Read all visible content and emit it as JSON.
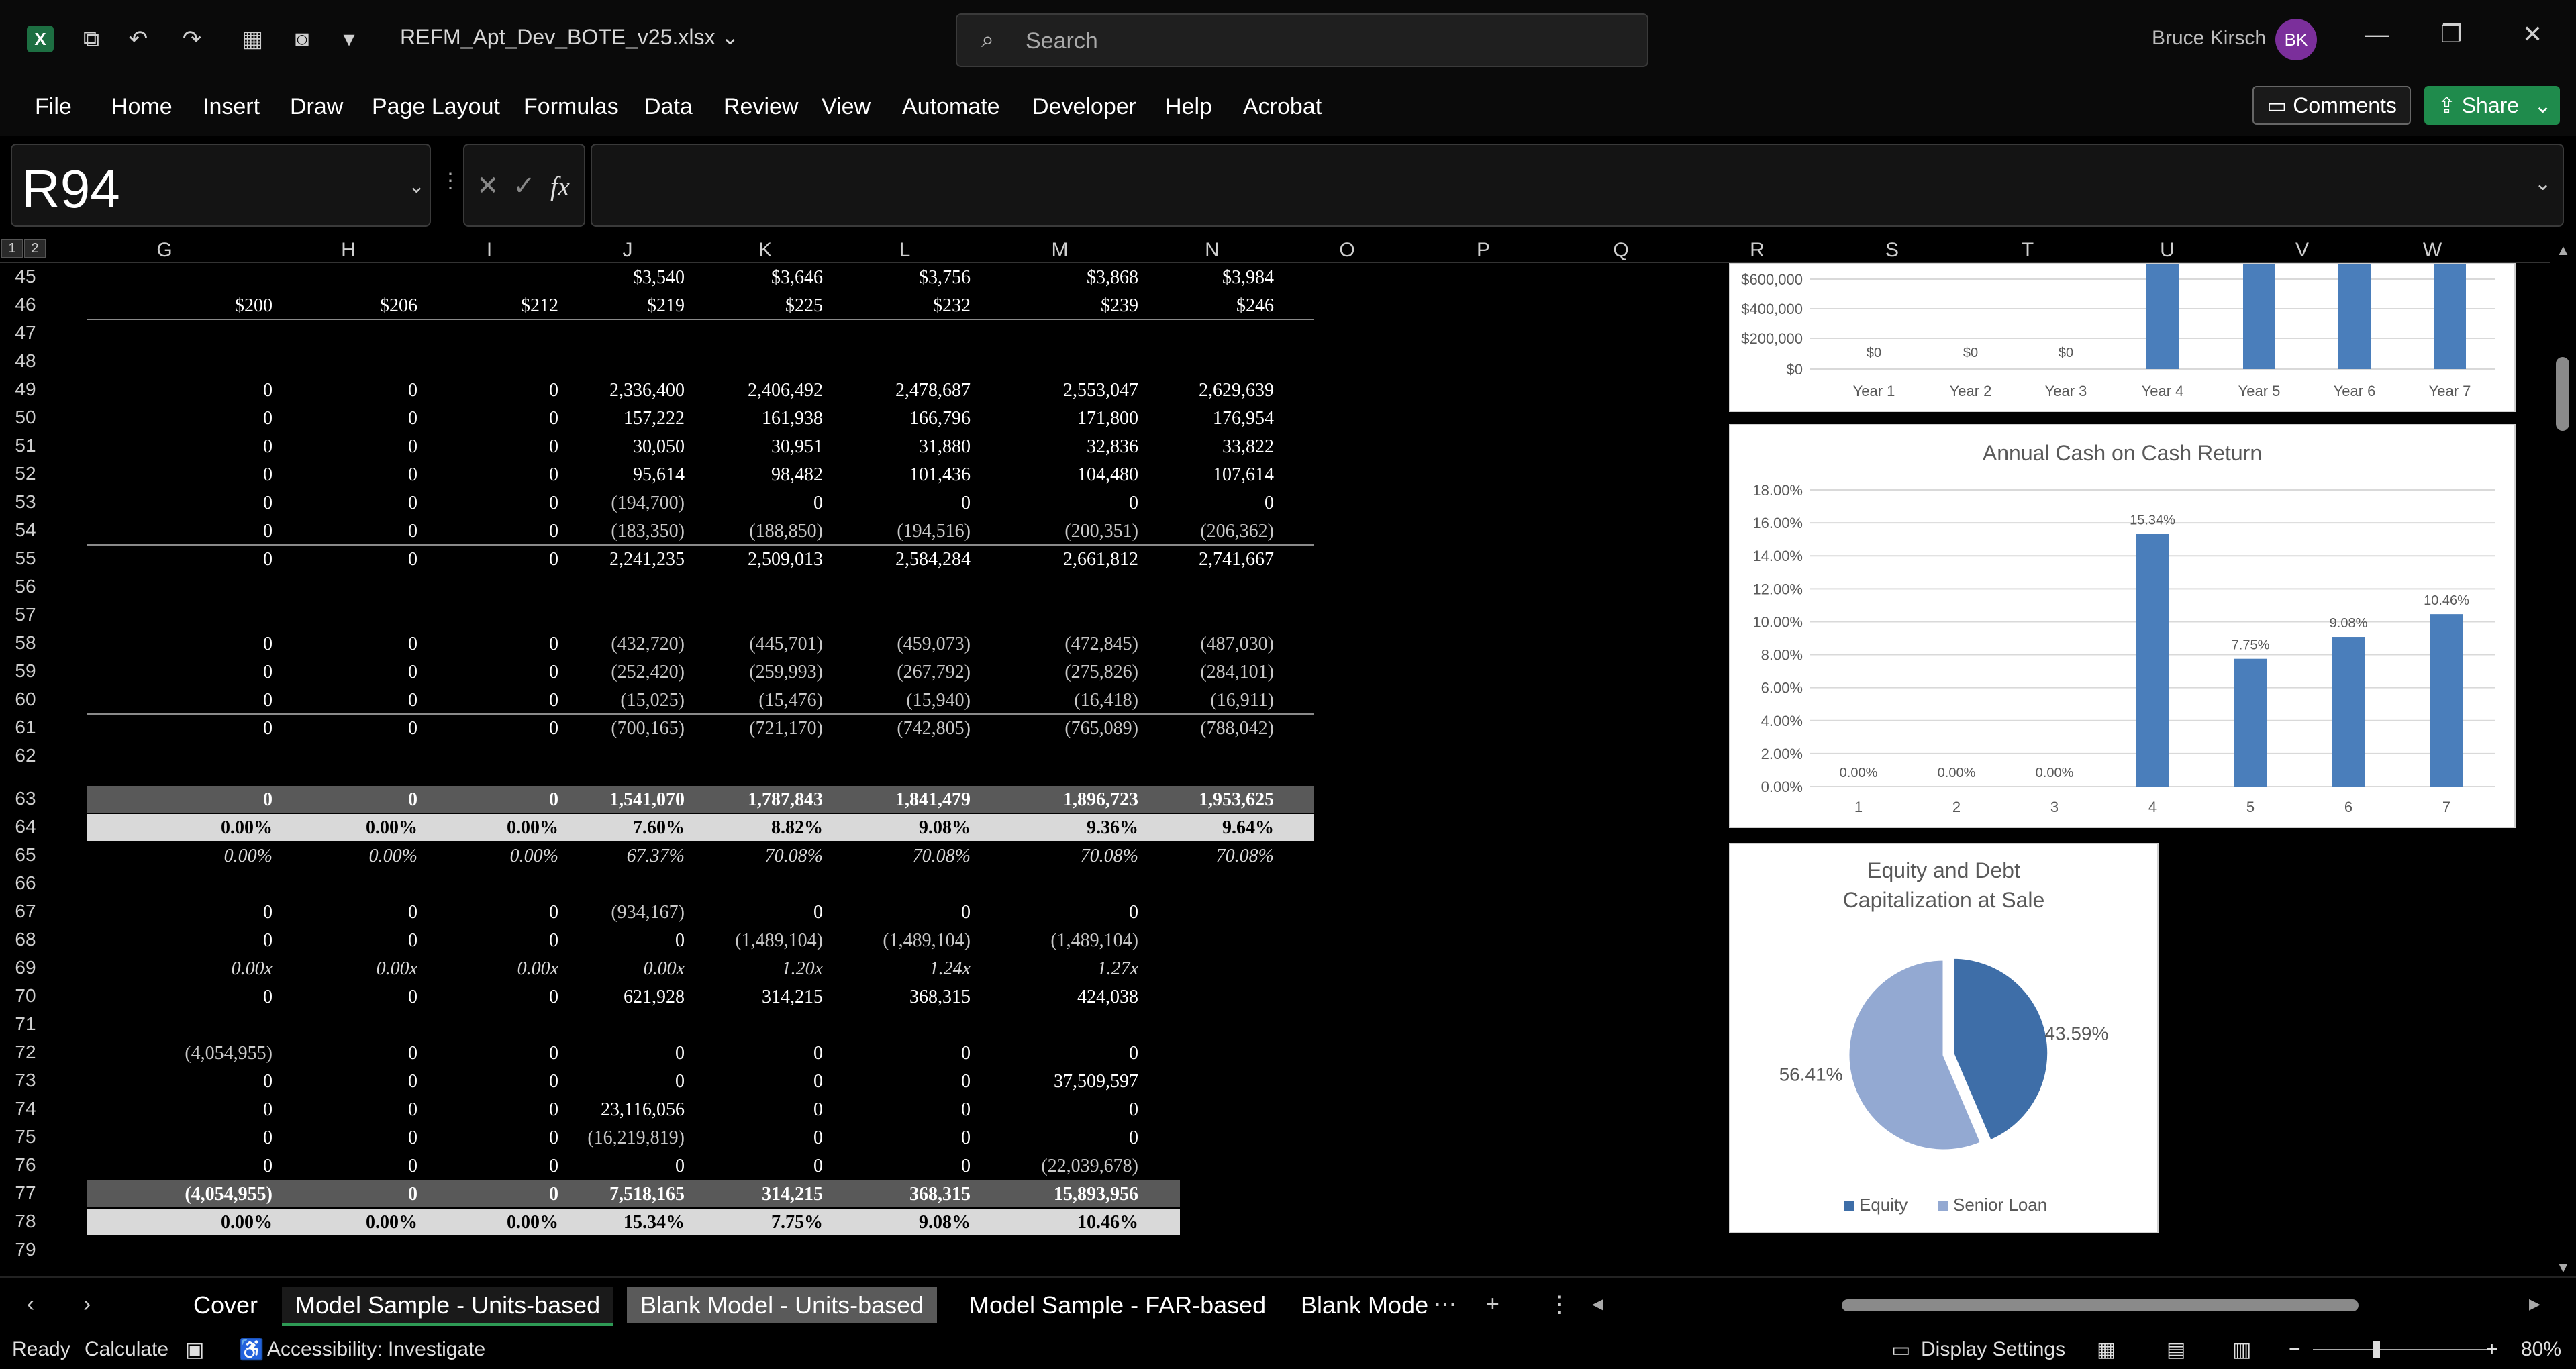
{
  "titlebar": {
    "doc_title": "REFM_Apt_Dev_BOTE_v25.xlsx",
    "search_placeholder": "Search",
    "user_name": "Bruce Kirsch",
    "user_initials": "BK"
  },
  "ribbon": {
    "tabs": [
      "File",
      "Home",
      "Insert",
      "Draw",
      "Page Layout",
      "Formulas",
      "Data",
      "Review",
      "View",
      "Automate",
      "Developer",
      "Help",
      "Acrobat"
    ],
    "comments_label": "Comments",
    "share_label": "Share"
  },
  "formula_bar": {
    "name_box": "R94",
    "formula": ""
  },
  "columns": [
    "G",
    "H",
    "I",
    "J",
    "K",
    "L",
    "M",
    "N",
    "O",
    "P",
    "Q",
    "R",
    "S",
    "T",
    "U",
    "V",
    "W"
  ],
  "rows": [
    "45",
    "46",
    "47",
    "48",
    "49",
    "50",
    "51",
    "52",
    "53",
    "54",
    "55",
    "56",
    "57",
    "58",
    "59",
    "60",
    "61",
    "62",
    "63",
    "64",
    "65",
    "66",
    "67",
    "68",
    "69",
    "70",
    "71",
    "72",
    "73",
    "74",
    "75",
    "76",
    "77",
    "78",
    "79"
  ],
  "cells": {
    "r45": [
      "",
      "",
      "",
      "$3,540",
      "$3,646",
      "$3,756",
      "$3,868",
      "$3,984"
    ],
    "r46": [
      "$200",
      "$206",
      "$212",
      "$219",
      "$225",
      "$232",
      "$239",
      "$246"
    ],
    "r49": [
      "0",
      "0",
      "0",
      "2,336,400",
      "2,406,492",
      "2,478,687",
      "2,553,047",
      "2,629,639"
    ],
    "r50": [
      "0",
      "0",
      "0",
      "157,222",
      "161,938",
      "166,796",
      "171,800",
      "176,954"
    ],
    "r51": [
      "0",
      "0",
      "0",
      "30,050",
      "30,951",
      "31,880",
      "32,836",
      "33,822"
    ],
    "r52": [
      "0",
      "0",
      "0",
      "95,614",
      "98,482",
      "101,436",
      "104,480",
      "107,614"
    ],
    "r53": [
      "0",
      "0",
      "0",
      "(194,700)",
      "0",
      "0",
      "0",
      "0"
    ],
    "r54": [
      "0",
      "0",
      "0",
      "(183,350)",
      "(188,850)",
      "(194,516)",
      "(200,351)",
      "(206,362)"
    ],
    "r55": [
      "0",
      "0",
      "0",
      "2,241,235",
      "2,509,013",
      "2,584,284",
      "2,661,812",
      "2,741,667"
    ],
    "r58": [
      "0",
      "0",
      "0",
      "(432,720)",
      "(445,701)",
      "(459,073)",
      "(472,845)",
      "(487,030)"
    ],
    "r59": [
      "0",
      "0",
      "0",
      "(252,420)",
      "(259,993)",
      "(267,792)",
      "(275,826)",
      "(284,101)"
    ],
    "r60": [
      "0",
      "0",
      "0",
      "(15,025)",
      "(15,476)",
      "(15,940)",
      "(16,418)",
      "(16,911)"
    ],
    "r61": [
      "0",
      "0",
      "0",
      "(700,165)",
      "(721,170)",
      "(742,805)",
      "(765,089)",
      "(788,042)"
    ],
    "r63": [
      "0",
      "0",
      "0",
      "1,541,070",
      "1,787,843",
      "1,841,479",
      "1,896,723",
      "1,953,625"
    ],
    "r64": [
      "0.00%",
      "0.00%",
      "0.00%",
      "7.60%",
      "8.82%",
      "9.08%",
      "9.36%",
      "9.64%"
    ],
    "r65": [
      "0.00%",
      "0.00%",
      "0.00%",
      "67.37%",
      "70.08%",
      "70.08%",
      "70.08%",
      "70.08%"
    ],
    "r67": [
      "0",
      "0",
      "0",
      "(934,167)",
      "0",
      "0",
      "0",
      ""
    ],
    "r68": [
      "0",
      "0",
      "0",
      "0",
      "(1,489,104)",
      "(1,489,104)",
      "(1,489,104)",
      ""
    ],
    "r69": [
      "0.00x",
      "0.00x",
      "0.00x",
      "0.00x",
      "1.20x",
      "1.24x",
      "1.27x",
      ""
    ],
    "r70": [
      "0",
      "0",
      "0",
      "621,928",
      "314,215",
      "368,315",
      "424,038",
      ""
    ],
    "r72": [
      "(4,054,955)",
      "0",
      "0",
      "0",
      "0",
      "0",
      "0",
      ""
    ],
    "r73": [
      "0",
      "0",
      "0",
      "0",
      "0",
      "0",
      "37,509,597",
      ""
    ],
    "r74": [
      "0",
      "0",
      "0",
      "23,116,056",
      "0",
      "0",
      "0",
      ""
    ],
    "r75": [
      "0",
      "0",
      "0",
      "(16,219,819)",
      "0",
      "0",
      "0",
      ""
    ],
    "r76": [
      "0",
      "0",
      "0",
      "0",
      "0",
      "0",
      "(22,039,678)",
      ""
    ],
    "r77": [
      "(4,054,955)",
      "0",
      "0",
      "7,518,165",
      "314,215",
      "368,315",
      "15,893,956",
      ""
    ],
    "r78": [
      "0.00%",
      "0.00%",
      "0.00%",
      "15.34%",
      "7.75%",
      "9.08%",
      "10.46%",
      ""
    ]
  },
  "chart_data": [
    {
      "type": "bar",
      "title": "",
      "categories": [
        "Year 1",
        "Year 2",
        "Year 3",
        "Year 4",
        "Year 5",
        "Year 6",
        "Year 7"
      ],
      "y_ticks_visible": [
        "$600,000",
        "$400,000",
        "$200,000",
        "$0"
      ],
      "data_labels_visible": [
        "$0",
        "$0",
        "$0"
      ],
      "values_note_visible": "bars for Year 4-7 extend above visible area"
    },
    {
      "type": "bar",
      "title": "Annual Cash on Cash Return",
      "categories": [
        "1",
        "2",
        "3",
        "4",
        "5",
        "6",
        "7"
      ],
      "values": [
        0,
        0,
        0,
        15.34,
        7.75,
        9.08,
        10.46
      ],
      "data_labels": [
        "0.00%",
        "0.00%",
        "0.00%",
        "15.34%",
        "7.75%",
        "9.08%",
        "10.46%"
      ],
      "y_ticks": [
        "18.00%",
        "16.00%",
        "14.00%",
        "12.00%",
        "10.00%",
        "8.00%",
        "6.00%",
        "4.00%",
        "2.00%",
        "0.00%"
      ],
      "ylim": [
        0,
        18
      ],
      "color": "#4a7ebb"
    },
    {
      "type": "pie",
      "title_line1": "Equity and Debt",
      "title_line2": "Capitalization at Sale",
      "series": [
        {
          "name": "Equity",
          "value": 43.59,
          "label": "43.59%",
          "color": "#3e6ea8"
        },
        {
          "name": "Senior Loan",
          "value": 56.41,
          "label": "56.41%",
          "color": "#93a9d2"
        }
      ]
    }
  ],
  "sheet_tabs": {
    "tabs": [
      "Cover",
      "Model Sample - Units-based",
      "Blank Model - Units-based",
      "Model Sample - FAR-based",
      "Blank Mode"
    ],
    "active": "Model Sample - Units-based"
  },
  "status": {
    "ready": "Ready",
    "calculate": "Calculate",
    "accessibility": "Accessibility: Investigate",
    "display_settings": "Display Settings",
    "zoom": "80%"
  }
}
